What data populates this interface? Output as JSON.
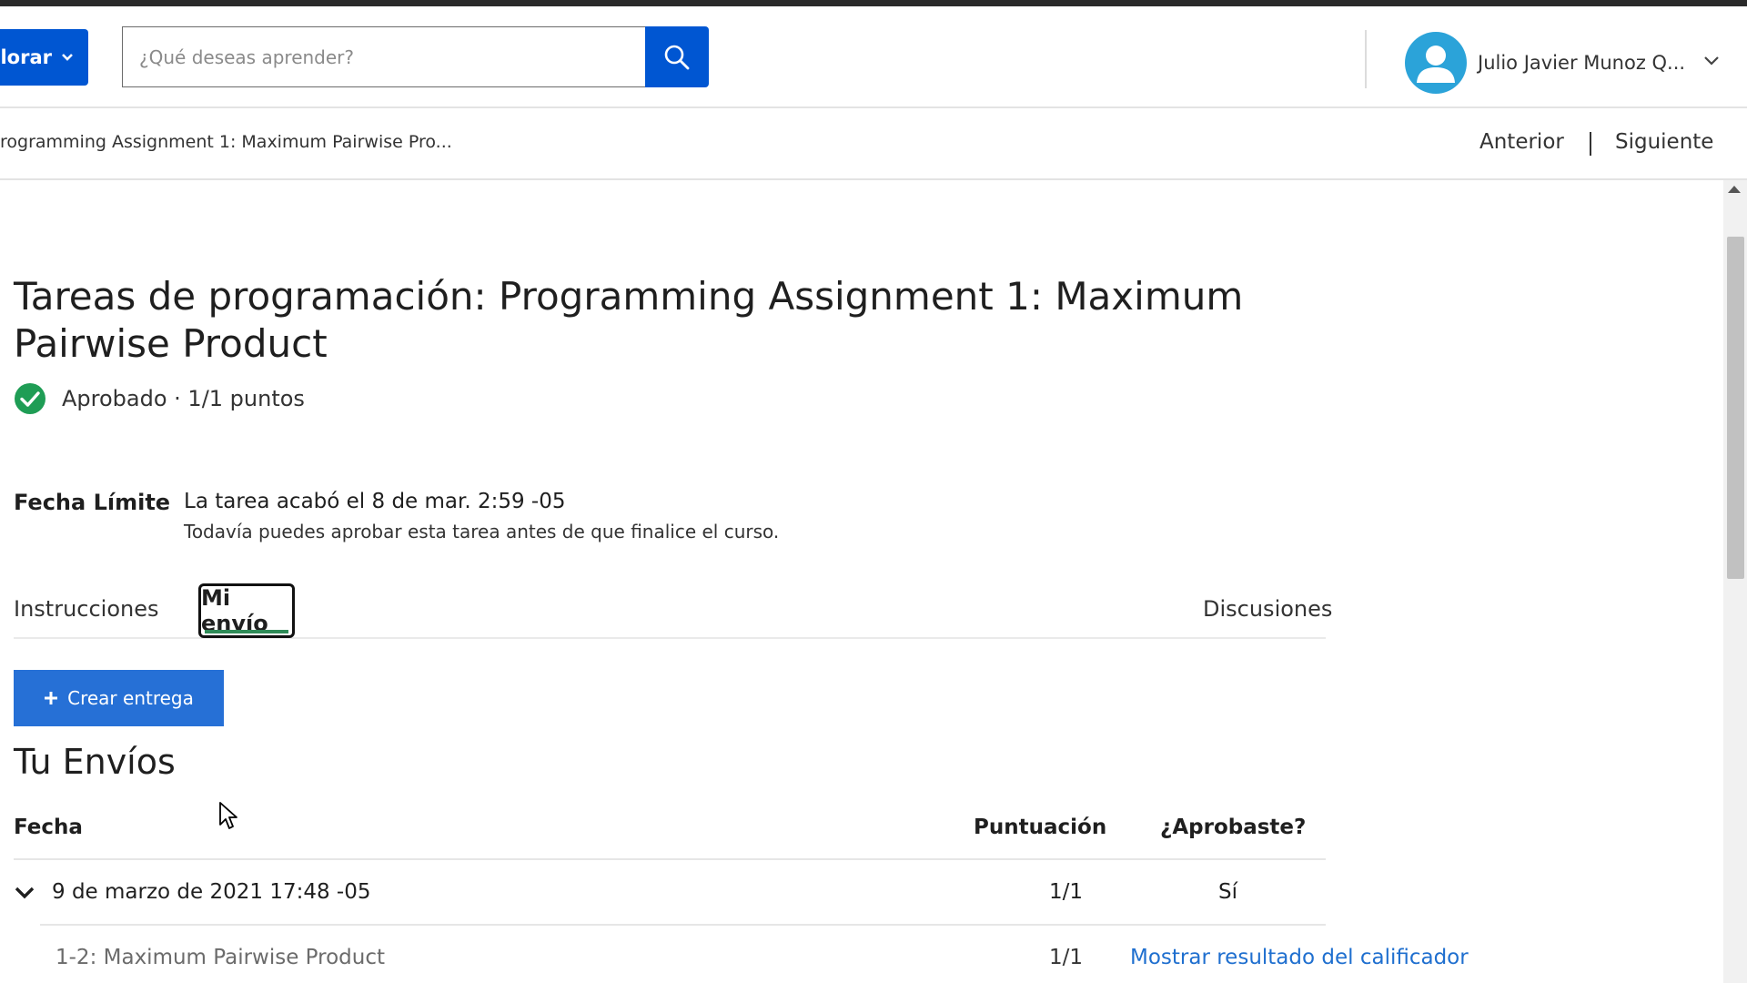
{
  "header": {
    "explore_label": "lorar",
    "search": {
      "placeholder": "¿Qué deseas aprender?"
    },
    "user_name": "Julio Javier Munoz Q..."
  },
  "subnav": {
    "breadcrumb": "rogramming Assignment 1: Maximum Pairwise Pro...",
    "prev_label": "Anterior",
    "next_label": "Siguiente"
  },
  "assignment": {
    "title": "Tareas de programación: Programming Assignment 1: Maximum Pairwise Product",
    "status": "Aprobado · 1/1 puntos",
    "status_color": "#1f9d55",
    "due_label": "Fecha Límite",
    "due_text": "La tarea acabó el 8 de mar. 2:59 -05",
    "due_note": "Todavía puedes aprobar esta tarea antes de que finalice el curso."
  },
  "tabs": [
    {
      "label": "Instrucciones",
      "active": false
    },
    {
      "label": "Mi envío",
      "active": true
    },
    {
      "label": "Discusiones",
      "active": false
    }
  ],
  "create_button_label": "Crear entrega",
  "submissions": {
    "title": "Tu Envíos",
    "columns": [
      "Fecha",
      "Puntuación",
      "¿Aprobaste?"
    ],
    "rows": [
      {
        "date": "9 de marzo de 2021 17:48 -05",
        "score": "1/1",
        "passed": "Sí",
        "parts": [
          {
            "name": "1-2: Maximum Pairwise Product",
            "score": "1/1",
            "link": "Mostrar resultado del calificador"
          }
        ]
      }
    ]
  },
  "colors": {
    "brand": "#0056d2",
    "button": "#2670d6",
    "link": "#1f6fcf",
    "success": "#1f9d55",
    "avatar": "#2ba3d9"
  }
}
